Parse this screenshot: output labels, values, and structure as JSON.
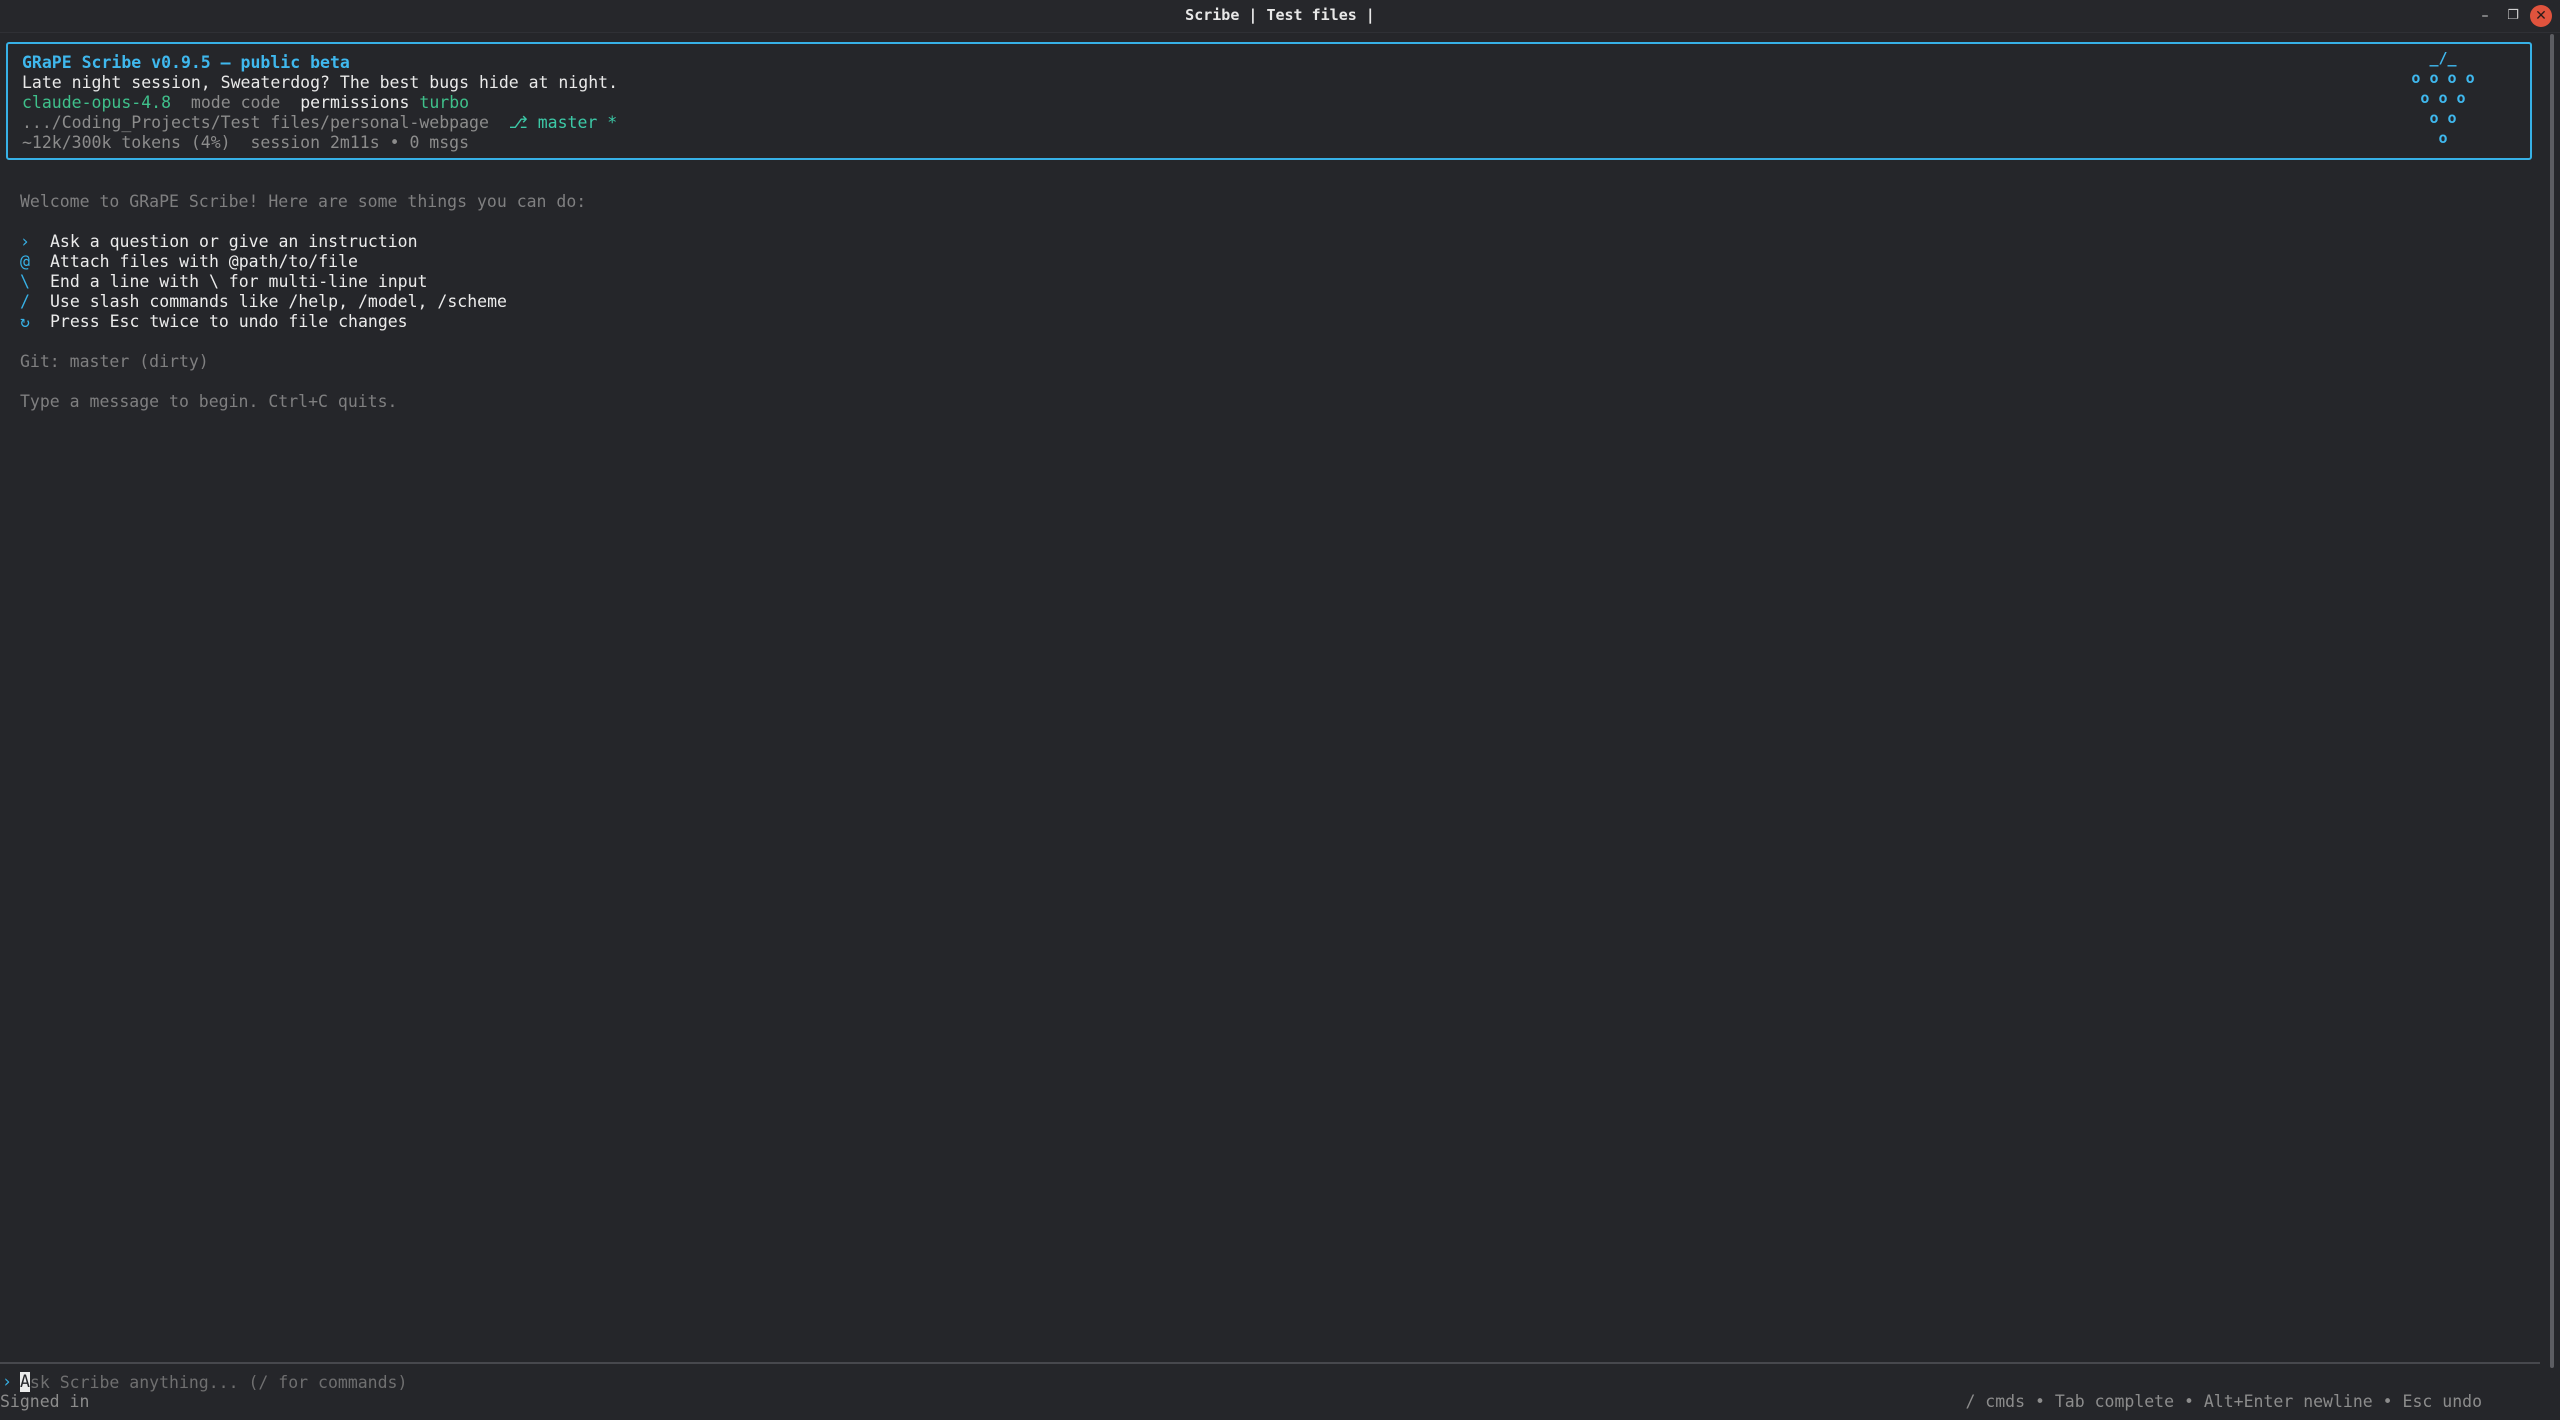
{
  "window": {
    "title": "Scribe | Test files |",
    "controls": {
      "minimize": "–",
      "maximize": "❐",
      "close": "✕"
    }
  },
  "header": {
    "title": "GRaPE Scribe v0.9.5 – public beta",
    "greeting": "Late night session, Sweaterdog? The best bugs hide at night.",
    "model": "claude-opus-4.8",
    "mode_label": "mode",
    "mode_value": "code",
    "permissions_label": "permissions",
    "permissions_value": "turbo",
    "path": ".../Coding_Projects/Test files/personal-webpage",
    "branch_icon": "⎇",
    "branch": "master *",
    "tokens": "~12k/300k tokens (4%)",
    "session": "session 2m11s • 0 msgs",
    "logo": "_/_\no o o o\no o o\no o\no"
  },
  "welcome": "Welcome to GRaPE Scribe! Here are some things you can do:",
  "tips": [
    {
      "icon": "›",
      "text": "Ask a question or give an instruction"
    },
    {
      "icon": "@",
      "text": "Attach files with @path/to/file"
    },
    {
      "icon": "\\",
      "text": "End a line with \\ for multi-line input"
    },
    {
      "icon": "/",
      "text": "Use slash commands like /help, /model, /scheme"
    },
    {
      "icon": "↻",
      "text": "Press Esc twice to undo file changes"
    }
  ],
  "git_status": "Git: master (dirty)",
  "hint": "Type a message to begin. Ctrl+C quits.",
  "input": {
    "prompt": "›",
    "cursor_char": "A",
    "placeholder": "Ask Scribe anything... (/ for commands)",
    "value": ""
  },
  "status": "Signed in",
  "shortcuts": "/ cmds • Tab complete • Alt+Enter newline • Esc undo",
  "colors": {
    "accent": "#37b1e6",
    "green": "#3fc08b",
    "background": "#25262a"
  }
}
